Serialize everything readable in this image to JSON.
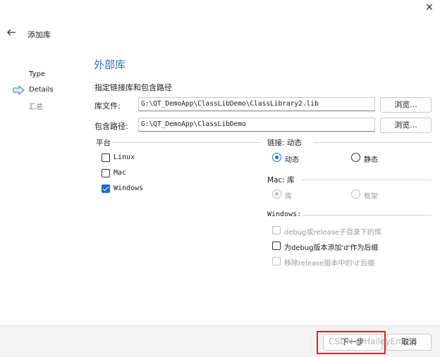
{
  "dialog": {
    "title": "添加库",
    "close_glyph": "✕"
  },
  "steps": [
    "Type",
    "Details",
    "汇总"
  ],
  "page": {
    "heading": "外部库",
    "subheading": "指定链接库和包含路径"
  },
  "fields": {
    "library_file": {
      "label": "库文件:",
      "value": "G:\\QT_DemoApp\\ClassLibDemo\\ClassLibrary2.lib",
      "browse_label": "浏览..."
    },
    "include_path": {
      "label": "包含路径:",
      "value": "G:\\QT_DemoApp\\ClassLibDemo",
      "browse_label": "浏览..."
    }
  },
  "platform": {
    "title": "平台",
    "options": [
      {
        "label": "Linux",
        "checked": false
      },
      {
        "label": "Mac",
        "checked": false
      },
      {
        "label": "Windows",
        "checked": true
      }
    ]
  },
  "linkage": {
    "title": "链接: 动态",
    "dynamic_label": "动态",
    "static_label": "静态",
    "selected": "dynamic"
  },
  "mac": {
    "title": "Mac: 库",
    "library_label": "库",
    "framework_label": "框架",
    "selected": "library",
    "enabled": false
  },
  "windows": {
    "title": "Windows:",
    "options": [
      {
        "label": "debug或release子目录下的库",
        "checked": false,
        "enabled": false
      },
      {
        "label": "为debug版本添加'd'作为后缀",
        "checked": false,
        "enabled": true
      },
      {
        "label": "移除release版本中的'd'后缀",
        "checked": false,
        "enabled": false
      }
    ]
  },
  "footer": {
    "next_label": "下一步",
    "cancel_label": "取消",
    "watermark": "CSDN @HaileyEmma"
  },
  "colors": {
    "accent": "#1b6fc4",
    "heading": "#2c6fb7",
    "highlight": "#e02222"
  }
}
